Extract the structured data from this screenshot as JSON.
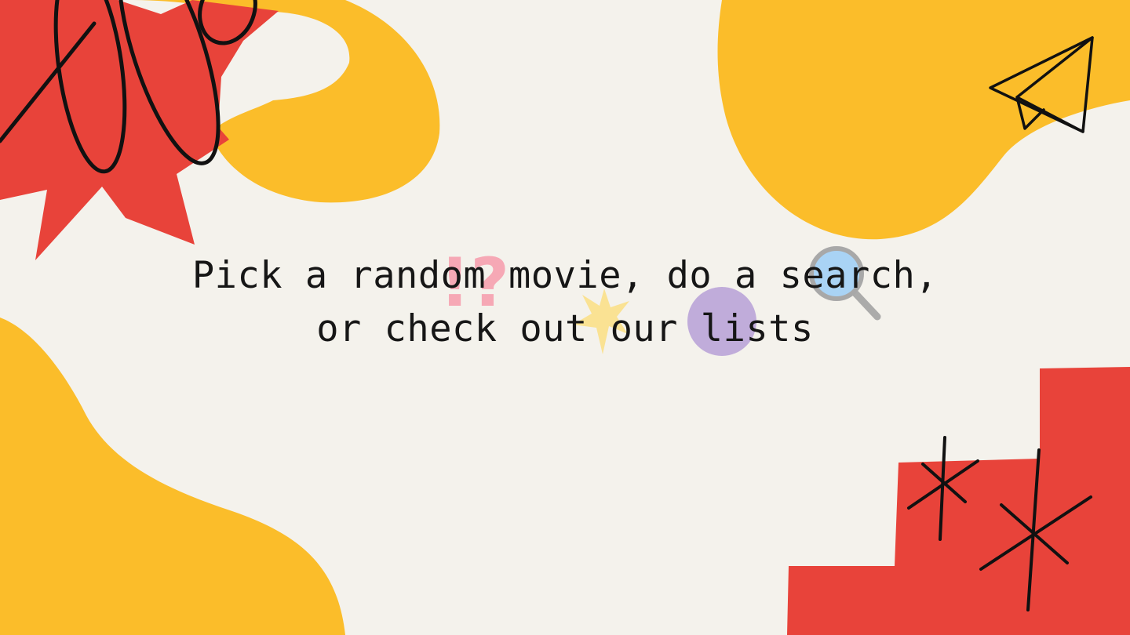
{
  "headline": {
    "line1": "Pick a random movie, do a search,",
    "line2": "or check out our lists"
  },
  "decorations": {
    "icons": [
      "red-starburst",
      "black-scribble-loops",
      "yellow-swirl",
      "yellow-blob",
      "paper-plane-icon",
      "pink-interrobang",
      "yellow-sparkle",
      "purple-dot",
      "magnifier-icon",
      "red-steps",
      "black-asterisks"
    ]
  },
  "colors": {
    "background": "#f4f2ec",
    "yellow": "#fbbd2a",
    "red": "#e8433a",
    "ink": "#161616",
    "pink": "#f7a1b0",
    "purple": "#b39ad6",
    "blue": "#a9d3f5"
  }
}
